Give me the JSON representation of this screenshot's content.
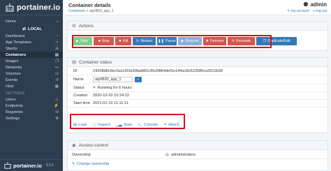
{
  "sidebar": {
    "brand": "portainer.io",
    "home_label": "Home",
    "environment_label": "LOCAL",
    "items": [
      {
        "label": "Dashboard",
        "icon": "tachometer-icon"
      },
      {
        "label": "App Templates",
        "icon": "rocket-icon"
      },
      {
        "label": "Stacks",
        "icon": "th-list-icon"
      },
      {
        "label": "Containers",
        "icon": "server-icon",
        "active": true
      },
      {
        "label": "Images",
        "icon": "clone-icon"
      },
      {
        "label": "Networks",
        "icon": "sitemap-icon"
      },
      {
        "label": "Volumes",
        "icon": "hdd-icon"
      },
      {
        "label": "Events",
        "icon": "history-icon"
      },
      {
        "label": "Host",
        "icon": "th-icon"
      }
    ],
    "settings_section": "SETTINGS",
    "settings_items": [
      {
        "label": "Users",
        "icon": "users-icon"
      },
      {
        "label": "Endpoints",
        "icon": "plug-icon"
      },
      {
        "label": "Registries",
        "icon": "database-icon"
      },
      {
        "label": "Settings",
        "icon": "cogs-icon"
      }
    ],
    "footer_brand": "portainer.io",
    "version": "2.0.1"
  },
  "header": {
    "title": "Container details",
    "breadcrumb_root": "Containers",
    "breadcrumb_sep": ">",
    "breadcrumb_current": "atp0820_app_1",
    "user": "admin",
    "my_account": "my account",
    "log_out": "log out"
  },
  "actions": {
    "heading": "Actions",
    "buttons": {
      "start": "Start",
      "stop": "Stop",
      "kill": "Kill",
      "restart": "Restart",
      "pause": "Pause",
      "resume": "Resume",
      "remove": "Remove",
      "recreate": "Recreate",
      "duplicate": "Duplicate/Edit"
    }
  },
  "status": {
    "heading": "Container status",
    "rows": {
      "id_label": "ID",
      "id_value": "24208d8c9ec5a1cf33a30ba982c35c6f864def1e144a18c523586ca3912b39",
      "name_label": "Name",
      "name_value": "atp0820_app_1",
      "status_label": "Status",
      "status_value": "Running for 6 hours",
      "created_label": "Created",
      "created_value": "2020-10-20 10:24:22",
      "start_label": "Start time",
      "start_value": "2021-01-10 11:11:11"
    },
    "links": {
      "logs": "Logs",
      "inspect": "Inspect",
      "stats": "Stats",
      "console": "Console",
      "attach": "Attach"
    }
  },
  "access": {
    "heading": "Access control",
    "ownership_label": "Ownership",
    "ownership_value": "administrators",
    "change_ownership": "Change ownership"
  },
  "colors": {
    "sidebar_bg": "#2d3e50",
    "primary": "#337ab7",
    "danger": "#d9534f",
    "success": "#7fcf8c",
    "highlight": "#d6111a"
  }
}
